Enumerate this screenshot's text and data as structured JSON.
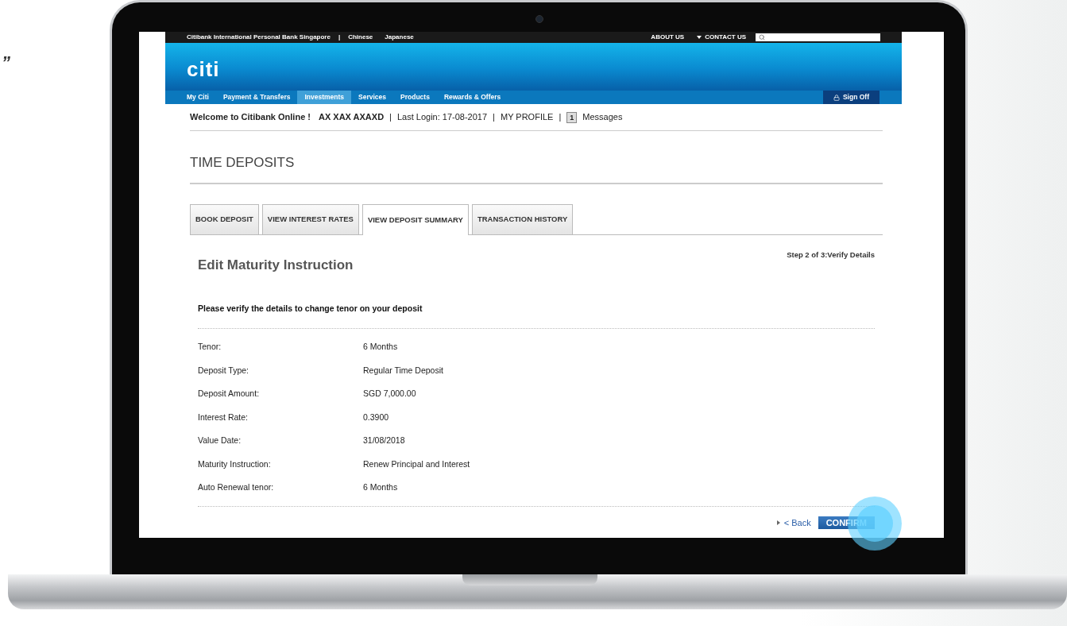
{
  "side_quote": "”",
  "top_bar": {
    "links": [
      "Citibank International Personal Bank Singapore",
      "Chinese",
      "Japanese"
    ],
    "separator": "|",
    "right_links": [
      "ABOUT US",
      "CONTACT US"
    ]
  },
  "logo": "citi",
  "nav": [
    {
      "label": "My Citi",
      "selected": false
    },
    {
      "label": "Payment & Transfers",
      "selected": false
    },
    {
      "label": "Investments",
      "selected": true
    },
    {
      "label": "Services",
      "selected": false
    },
    {
      "label": "Products",
      "selected": false
    },
    {
      "label": "Rewards & Offers",
      "selected": false
    }
  ],
  "sign_off": "Sign Off",
  "welcome": {
    "greeting": "Welcome to Citibank Online !",
    "name": "AX XAX AXAXD",
    "separator": "|",
    "last_login": "Last Login: 17-08-2017",
    "profile": "MY PROFILE",
    "message_count": "1",
    "messages": "Messages"
  },
  "page_title": "TIME DEPOSITS",
  "tabs": [
    {
      "label": "BOOK DEPOSIT",
      "selected": false
    },
    {
      "label": "VIEW INTEREST RATES",
      "selected": false
    },
    {
      "label": "VIEW DEPOSIT SUMMARY",
      "selected": true
    },
    {
      "label": "TRANSACTION HISTORY",
      "selected": false
    }
  ],
  "section": {
    "title": "Edit Maturity Instruction",
    "step": "Step 2 of 3:Verify Details",
    "instruction": "Please verify the details to change tenor on your deposit"
  },
  "details": [
    {
      "label": "Tenor:",
      "value": "6 Months"
    },
    {
      "label": "Deposit Type:",
      "value": "Regular Time Deposit"
    },
    {
      "label": "Deposit Amount:",
      "value": "SGD 7,000.00"
    },
    {
      "label": "Interest Rate:",
      "value": "0.3900"
    },
    {
      "label": "Value Date:",
      "value": "31/08/2018"
    },
    {
      "label": "Maturity Instruction:",
      "value": "Renew Principal and Interest"
    },
    {
      "label": "Auto Renewal tenor:",
      "value": "6 Months"
    }
  ],
  "actions": {
    "back": "< Back",
    "confirm": "CONFIRM"
  }
}
